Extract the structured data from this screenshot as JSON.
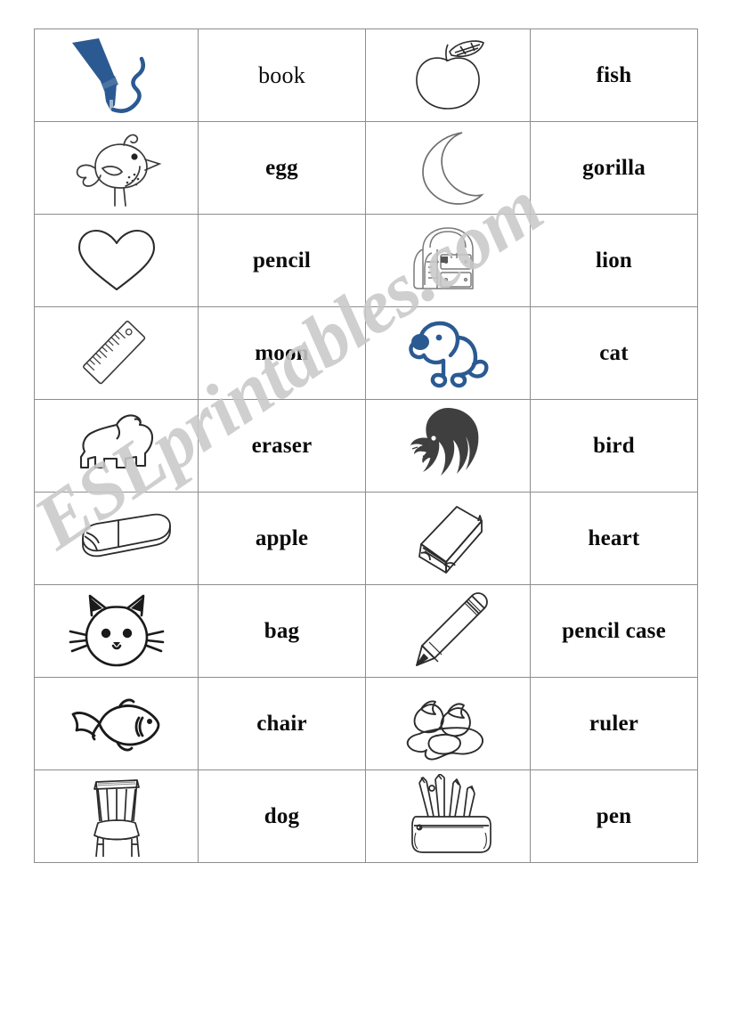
{
  "document": {
    "type": "esl-vocabulary-matching-worksheet",
    "watermark": "ESLprintables.com",
    "watermark_color": "#c9c9c9",
    "accent_blue": "#2b5a92",
    "line_color": "#8d8d8d",
    "page_background": "#ffffff"
  },
  "table": {
    "columns": 4,
    "rows": 9,
    "column_roles": [
      "picture",
      "word",
      "picture",
      "word"
    ],
    "rows_data": [
      {
        "pic_left": {
          "icon": "fountain-pen-icon",
          "label": "pen",
          "color": "#2b5a92"
        },
        "word_left": "book",
        "pic_right": {
          "icon": "apple-icon",
          "label": "apple",
          "color": "#2b2b2b"
        },
        "word_right": "fish"
      },
      {
        "pic_left": {
          "icon": "bird-icon",
          "label": "bird",
          "color": "#2b2b2b"
        },
        "word_left": "egg",
        "pic_right": {
          "icon": "moon-icon",
          "label": "moon",
          "color": "#6f6f6f"
        },
        "word_right": "gorilla"
      },
      {
        "pic_left": {
          "icon": "heart-icon",
          "label": "heart",
          "color": "#2b2b2b"
        },
        "word_left": "pencil",
        "pic_right": {
          "icon": "backpack-icon",
          "label": "bag",
          "color": "#7b7b7b"
        },
        "word_right": "lion"
      },
      {
        "pic_left": {
          "icon": "ruler-icon",
          "label": "ruler",
          "color": "#3a3a3a"
        },
        "word_left": "moon",
        "pic_right": {
          "icon": "dog-icon",
          "label": "dog",
          "color": "#2b5a92"
        },
        "word_right": "cat"
      },
      {
        "pic_left": {
          "icon": "gorilla-icon",
          "label": "gorilla",
          "color": "#2b2b2b"
        },
        "word_left": "eraser",
        "pic_right": {
          "icon": "lion-head-icon",
          "label": "lion",
          "color": "#3a3a3a"
        },
        "word_right": "bird"
      },
      {
        "pic_left": {
          "icon": "eraser-icon",
          "label": "eraser",
          "color": "#2b2b2b"
        },
        "word_left": "apple",
        "pic_right": {
          "icon": "book-icon",
          "label": "book",
          "color": "#2b2b2b"
        },
        "word_right": "heart"
      },
      {
        "pic_left": {
          "icon": "cat-face-icon",
          "label": "cat",
          "color": "#1a1a1a"
        },
        "word_left": "bag",
        "pic_right": {
          "icon": "pencil-icon",
          "label": "pencil",
          "color": "#2b2b2b"
        },
        "word_right": "pencil case"
      },
      {
        "pic_left": {
          "icon": "fish-icon",
          "label": "fish",
          "color": "#1a1a1a"
        },
        "word_left": "chair",
        "pic_right": {
          "icon": "egg-icon",
          "label": "egg",
          "color": "#2b2b2b"
        },
        "word_right": "ruler"
      },
      {
        "pic_left": {
          "icon": "chair-icon",
          "label": "chair",
          "color": "#2b2b2b"
        },
        "word_left": "dog",
        "pic_right": {
          "icon": "pencil-case-icon",
          "label": "pencil case",
          "color": "#2b2b2b"
        },
        "word_right": "pen"
      }
    ],
    "word_styles": {
      "book": "regular",
      "default": "bold"
    }
  }
}
